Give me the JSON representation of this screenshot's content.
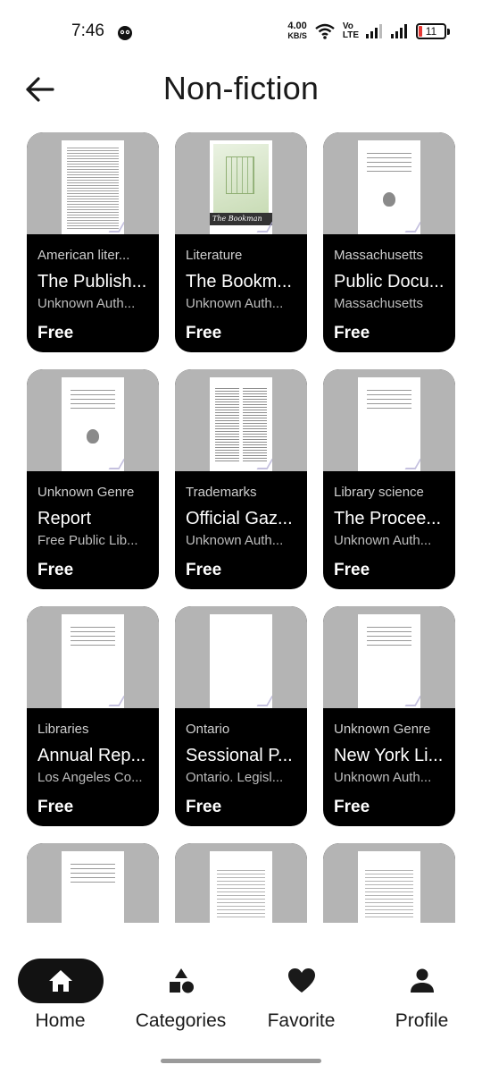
{
  "status_bar": {
    "time": "7:46",
    "net_speed_value": "4.00",
    "net_speed_unit": "KB/S",
    "volte_top": "Vo",
    "volte_bottom": "LTE",
    "battery": "11"
  },
  "header": {
    "title": "Non-fiction"
  },
  "books": [
    {
      "genre": "American liter...",
      "title": "The Publish...",
      "author": "Unknown Auth...",
      "price": "Free",
      "cover": "text"
    },
    {
      "genre": "Literature",
      "title": "The Bookm...",
      "author": "Unknown Auth...",
      "price": "Free",
      "cover": "bookman",
      "cover_band_text": "The Bookman"
    },
    {
      "genre": "Massachusetts",
      "title": "Public Docu...",
      "author": "Massachusetts",
      "price": "Free",
      "cover": "seal"
    },
    {
      "genre": "Unknown Genre",
      "title": "Report",
      "author": "Free Public Lib...",
      "price": "Free",
      "cover": "seal"
    },
    {
      "genre": "Trademarks",
      "title": "Official Gaz...",
      "author": "Unknown Auth...",
      "price": "Free",
      "cover": "twocol"
    },
    {
      "genre": "Library science",
      "title": "The Procee...",
      "author": "Unknown Auth...",
      "price": "Free",
      "cover": "titlepage"
    },
    {
      "genre": "Libraries",
      "title": "Annual Rep...",
      "author": "Los Angeles Co...",
      "price": "Free",
      "cover": "titlepage"
    },
    {
      "genre": "Ontario",
      "title": "Sessional P...",
      "author": "Ontario. Legisl...",
      "price": "Free",
      "cover": "blank"
    },
    {
      "genre": "Unknown Genre",
      "title": "New York Li...",
      "author": "Unknown Auth...",
      "price": "Free",
      "cover": "titlepage"
    },
    {
      "genre": "",
      "title": "",
      "author": "",
      "price": "",
      "cover": "titlepage"
    },
    {
      "genre": "",
      "title": "",
      "author": "",
      "price": "",
      "cover": "toc"
    },
    {
      "genre": "",
      "title": "",
      "author": "",
      "price": "",
      "cover": "toc"
    }
  ],
  "nav": {
    "items": [
      {
        "label": "Home",
        "icon": "home-icon",
        "active": true
      },
      {
        "label": "Categories",
        "icon": "categories-icon",
        "active": false
      },
      {
        "label": "Favorite",
        "icon": "heart-icon",
        "active": false
      },
      {
        "label": "Profile",
        "icon": "person-icon",
        "active": false
      }
    ]
  }
}
